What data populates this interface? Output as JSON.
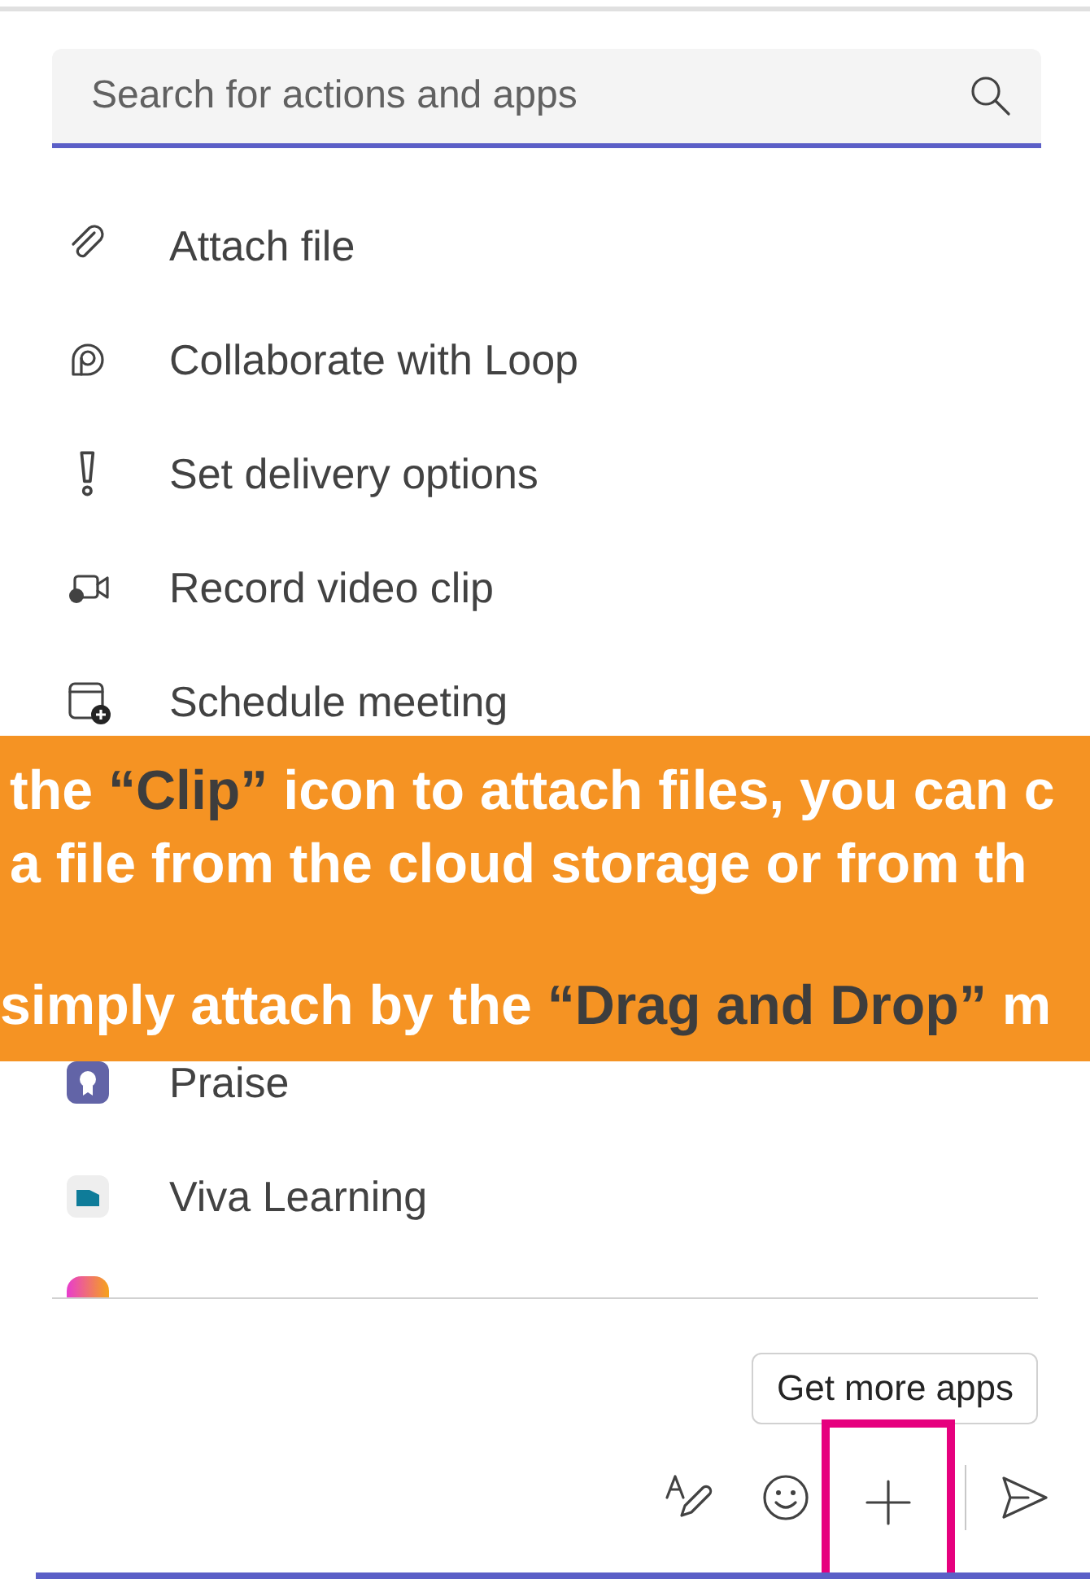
{
  "search": {
    "placeholder": "Search for actions and apps"
  },
  "actions": [
    {
      "label": "Attach file"
    },
    {
      "label": "Collaborate with Loop"
    },
    {
      "label": "Set delivery options"
    },
    {
      "label": "Record video clip"
    },
    {
      "label": "Schedule meeting"
    }
  ],
  "apps": [
    {
      "label": "Praise",
      "clipped": false
    },
    {
      "label": "Viva Learning",
      "clipped": false
    },
    {
      "clipped": true
    }
  ],
  "get_more_apps": "Get more apps",
  "toolbar": [
    {
      "kind": "format",
      "highlighted": false
    },
    {
      "kind": "emoji",
      "highlighted": false
    },
    {
      "kind": "plus",
      "highlighted": true
    },
    {
      "kind": "send",
      "highlighted": false
    }
  ],
  "banner": {
    "paragraphs": [
      [
        "the **“Clip”** icon to attach files, you can c",
        "a file from the cloud storage or from th"
      ],
      [
        "simply attach by the **“Drag and Drop”** m"
      ]
    ]
  }
}
